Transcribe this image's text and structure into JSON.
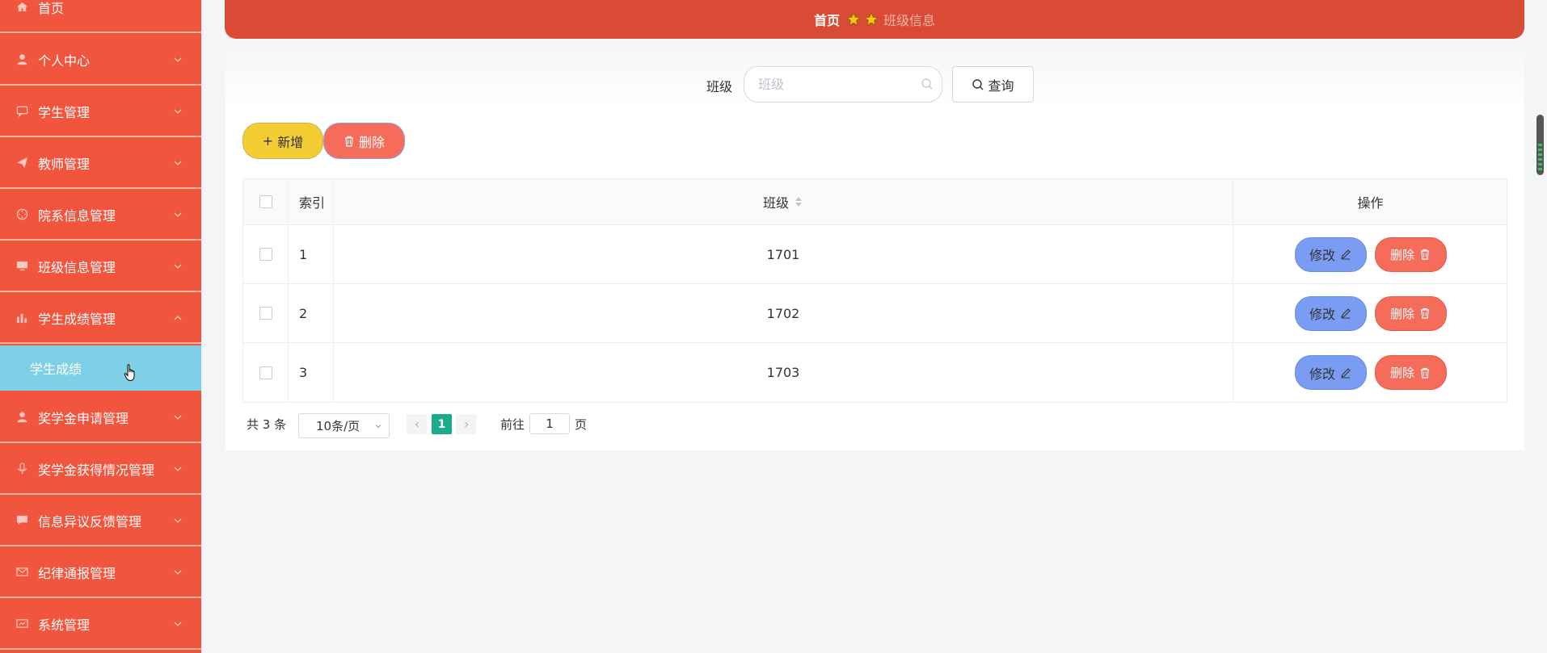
{
  "sidebar": {
    "items": [
      {
        "label": "首页",
        "icon": "home-icon"
      },
      {
        "label": "个人中心",
        "icon": "user-icon"
      },
      {
        "label": "学生管理",
        "icon": "chat-icon"
      },
      {
        "label": "教师管理",
        "icon": "send-icon"
      },
      {
        "label": "院系信息管理",
        "icon": "compass-icon"
      },
      {
        "label": "班级信息管理",
        "icon": "monitor-icon"
      },
      {
        "label": "学生成绩管理",
        "icon": "chart-icon"
      },
      {
        "label": "奖学金申请管理",
        "icon": "user-icon"
      },
      {
        "label": "奖学金获得情况管理",
        "icon": "mic-icon"
      },
      {
        "label": "信息异议反馈管理",
        "icon": "message-icon"
      },
      {
        "label": "纪律通报管理",
        "icon": "mail-icon"
      },
      {
        "label": "系统管理",
        "icon": "settings-icon"
      }
    ],
    "sub_item": {
      "label": "学生成绩"
    }
  },
  "breadcrumb": {
    "home": "首页",
    "current": "班级信息"
  },
  "search": {
    "label": "班级",
    "placeholder": "班级",
    "value": "",
    "button": "查询"
  },
  "toolbar": {
    "add_label": "新增",
    "delete_label": "删除"
  },
  "table": {
    "headers": {
      "index": "索引",
      "class": "班级",
      "actions": "操作"
    },
    "rows": [
      {
        "index": "1",
        "class": "1701"
      },
      {
        "index": "2",
        "class": "1702"
      },
      {
        "index": "3",
        "class": "1703"
      }
    ],
    "edit_label": "修改",
    "delete_label": "删除"
  },
  "pagination": {
    "total": "共 3 条",
    "page_size": "10条/页",
    "current_page": "1",
    "goto_label": "前往",
    "goto_value": "1",
    "goto_suffix": "页"
  },
  "colors": {
    "sidebar": "#f2553e",
    "breadcrumb_bar": "#d94b35",
    "active_submenu": "#7fd0e6",
    "add_button": "#f2cd34",
    "delete_button": "#f56c5b",
    "edit_button": "#7b9cf3",
    "current_page": "#1aab8a"
  }
}
